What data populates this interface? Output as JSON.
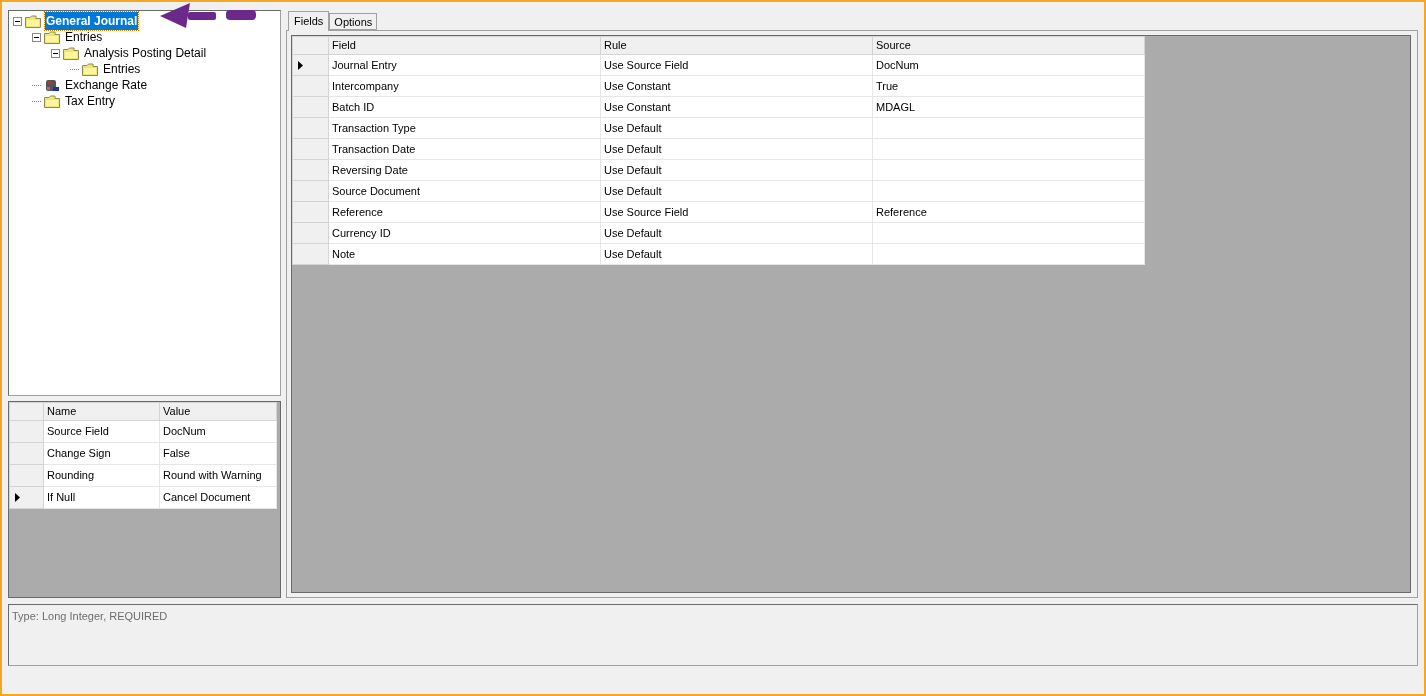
{
  "tree": [
    {
      "label": "General Journal",
      "kind": "folder",
      "selected": true,
      "expanded": true,
      "children": [
        {
          "label": "Entries",
          "kind": "folder",
          "selected": false,
          "expanded": true,
          "children": [
            {
              "label": "Analysis Posting Detail",
              "kind": "folder",
              "selected": false,
              "expanded": true,
              "children": [
                {
                  "label": "Entries",
                  "kind": "folder",
                  "selected": false
                }
              ]
            }
          ]
        },
        {
          "label": "Exchange Rate",
          "kind": "rate",
          "selected": false
        },
        {
          "label": "Tax Entry",
          "kind": "folder",
          "selected": false
        }
      ]
    }
  ],
  "properties": {
    "columns": [
      "Name",
      "Value"
    ],
    "rows": [
      {
        "cells": [
          "Source Field",
          "DocNum"
        ],
        "selected": false
      },
      {
        "cells": [
          "Change Sign",
          "False"
        ],
        "selected": false
      },
      {
        "cells": [
          "Rounding",
          "Round with Warning"
        ],
        "selected": false
      },
      {
        "cells": [
          "If Null",
          "Cancel Document"
        ],
        "selected": true
      }
    ]
  },
  "tabs": [
    {
      "label": "Fields",
      "selected": true
    },
    {
      "label": "Options",
      "selected": false
    }
  ],
  "fields": {
    "columns": [
      "Field",
      "Rule",
      "Source"
    ],
    "rows": [
      {
        "cells": [
          "Journal Entry",
          "Use Source Field",
          "DocNum"
        ],
        "selected": true
      },
      {
        "cells": [
          "Intercompany",
          "Use Constant",
          "True"
        ],
        "selected": false
      },
      {
        "cells": [
          "Batch ID",
          "Use Constant",
          "MDAGL"
        ],
        "selected": false
      },
      {
        "cells": [
          "Transaction Type",
          "Use Default",
          ""
        ],
        "selected": false
      },
      {
        "cells": [
          "Transaction Date",
          "Use Default",
          ""
        ],
        "selected": false
      },
      {
        "cells": [
          "Reversing Date",
          "Use Default",
          ""
        ],
        "selected": false
      },
      {
        "cells": [
          "Source Document",
          "Use Default",
          ""
        ],
        "selected": false
      },
      {
        "cells": [
          "Reference",
          "Use Source Field",
          "Reference"
        ],
        "selected": false
      },
      {
        "cells": [
          "Currency ID",
          "Use Default",
          ""
        ],
        "selected": false
      },
      {
        "cells": [
          "Note",
          "Use Default",
          ""
        ],
        "selected": false
      }
    ]
  },
  "description": "Type: Long Integer, REQUIRED"
}
